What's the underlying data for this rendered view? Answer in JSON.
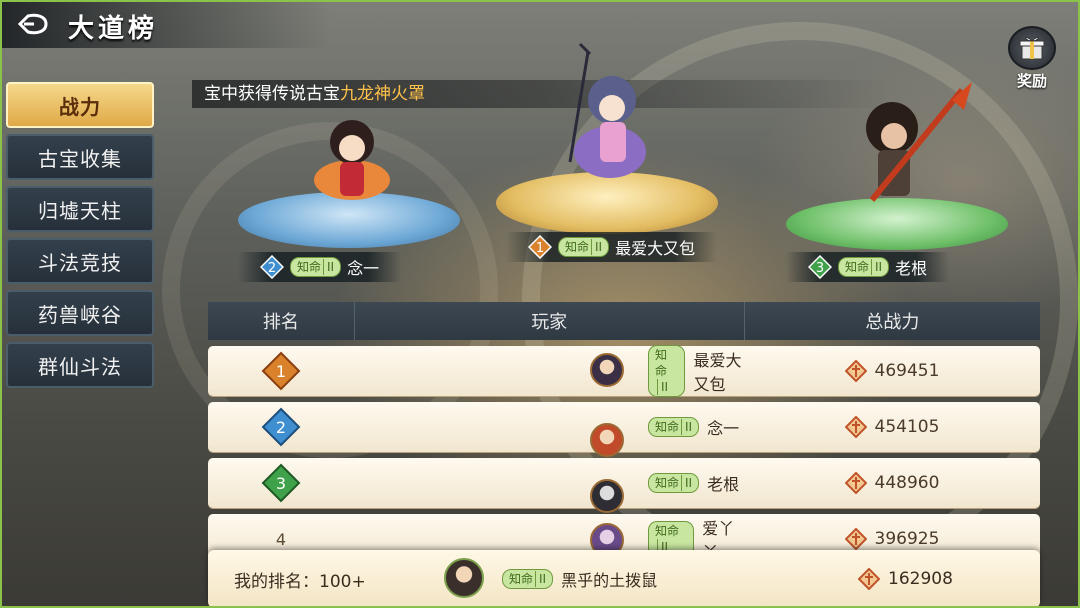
{
  "header": {
    "title": "大道榜"
  },
  "reward": {
    "label": "奖励"
  },
  "sidebar": {
    "tabs": [
      {
        "label": "战力",
        "active": true
      },
      {
        "label": "古宝收集",
        "active": false
      },
      {
        "label": "归墟天柱",
        "active": false
      },
      {
        "label": "斗法竞技",
        "active": false
      },
      {
        "label": "药兽峡谷",
        "active": false
      },
      {
        "label": "群仙斗法",
        "active": false
      }
    ]
  },
  "banner": {
    "prefix": "宝中获得传说古宝",
    "item": "九龙神火罩"
  },
  "podium": [
    {
      "rank": "1",
      "tag": "知命",
      "tag_level": "II",
      "name": "最爱大又包",
      "color": "#d9822b"
    },
    {
      "rank": "2",
      "tag": "知命",
      "tag_level": "II",
      "name": "念一",
      "color": "#3f8fd0"
    },
    {
      "rank": "3",
      "tag": "知命",
      "tag_level": "II",
      "name": "老根",
      "color": "#3fa14a"
    }
  ],
  "table": {
    "headers": {
      "rank": "排名",
      "player": "玩家",
      "power": "总战力"
    },
    "rows": [
      {
        "rank": "1",
        "tag": "知命",
        "tag_level": "II",
        "name": "最爱大又包",
        "power": "469451",
        "color": "#d9822b"
      },
      {
        "rank": "2",
        "tag": "知命",
        "tag_level": "II",
        "name": "念一",
        "power": "454105",
        "color": "#3f8fd0"
      },
      {
        "rank": "3",
        "tag": "知命",
        "tag_level": "II",
        "name": "老根",
        "power": "448960",
        "color": "#3fa14a"
      },
      {
        "rank": "4",
        "tag": "知命",
        "tag_level": "II",
        "name": "爱丫丫",
        "power": "396925",
        "color": ""
      }
    ]
  },
  "my_rank": {
    "label": "我的排名：100+",
    "tag": "知命",
    "tag_level": "II",
    "name": "黑乎的土拨鼠",
    "power": "162908"
  }
}
